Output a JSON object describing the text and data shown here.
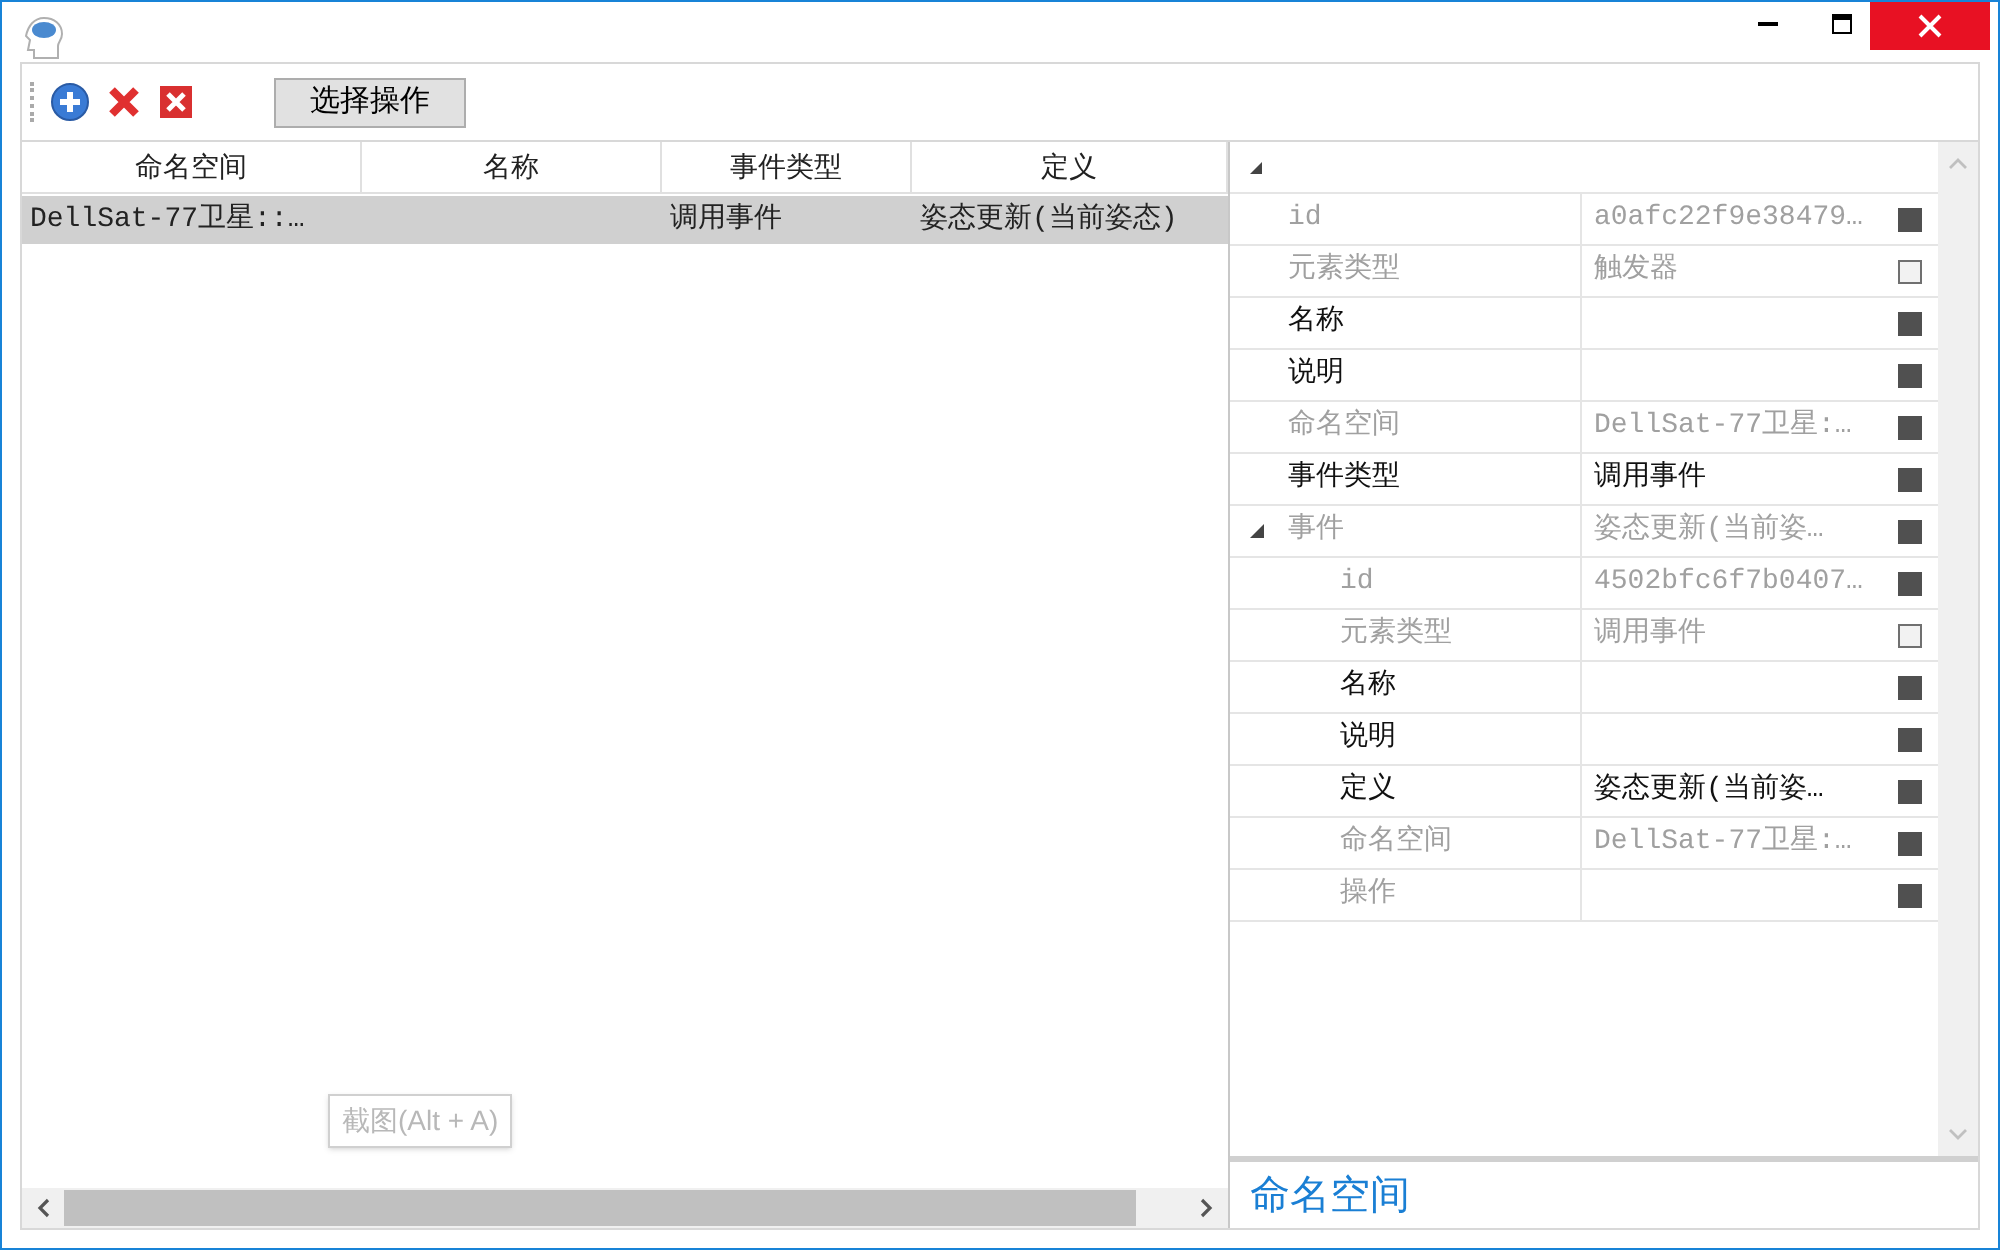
{
  "toolbar": {
    "button": "选择操作"
  },
  "table": {
    "columns": [
      "命名空间",
      "名称",
      "事件类型",
      "定义"
    ],
    "rows": [
      {
        "selected": true,
        "cells": [
          "DellSat-77卫星::…",
          null,
          "调用事件",
          "姿态更新(当前姿态)"
        ]
      }
    ]
  },
  "tooltip": "截图(Alt + A)",
  "property_grid": {
    "expanded": true,
    "properties": [
      {
        "label": "id",
        "value": "a0afc22f9e38479…",
        "disabled": true,
        "filled": true
      },
      {
        "label": "元素类型",
        "value": "触发器",
        "disabled": true,
        "filled": false
      },
      {
        "label": "名称",
        "disabled": false,
        "filled": true
      },
      {
        "label": "说明",
        "disabled": false,
        "filled": true
      },
      {
        "label": "命名空间",
        "value": "DellSat-77卫星:…",
        "disabled": true,
        "filled": true
      },
      {
        "label": "事件类型",
        "value": "调用事件",
        "disabled": false,
        "filled": true
      },
      {
        "label": "事件",
        "value": "姿态更新(当前姿…",
        "disabled": true,
        "filled": true,
        "expanded": true,
        "children": [
          {
            "label": "id",
            "value": "4502bfc6f7b0407…",
            "disabled": true,
            "filled": true
          },
          {
            "label": "元素类型",
            "value": "调用事件",
            "disabled": true,
            "filled": false
          },
          {
            "label": "名称",
            "disabled": false,
            "filled": true
          },
          {
            "label": "说明",
            "disabled": false,
            "filled": true
          },
          {
            "label": "定义",
            "value": "姿态更新(当前姿…",
            "disabled": false,
            "filled": true
          },
          {
            "label": "命名空间",
            "value": "DellSat-77卫星:…",
            "disabled": true,
            "filled": true
          },
          {
            "label": "操作",
            "disabled": true,
            "filled": true
          }
        ]
      }
    ]
  },
  "description": "命名空间"
}
